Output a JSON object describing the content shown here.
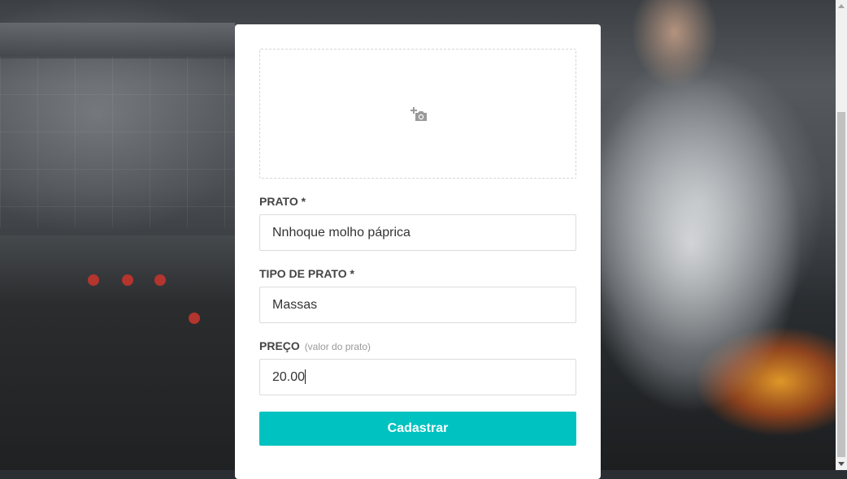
{
  "upload": {
    "icon": "add-photo-icon"
  },
  "form": {
    "prato_label": "PRATO *",
    "prato_value": "Nnhoque molho páprica",
    "tipo_label": "TIPO DE PRATO *",
    "tipo_value": "Massas",
    "preco_label": "PREÇO",
    "preco_hint": "(valor do prato)",
    "preco_value": "20.00",
    "submit_label": "Cadastrar"
  },
  "colors": {
    "accent": "#00c2c0"
  }
}
